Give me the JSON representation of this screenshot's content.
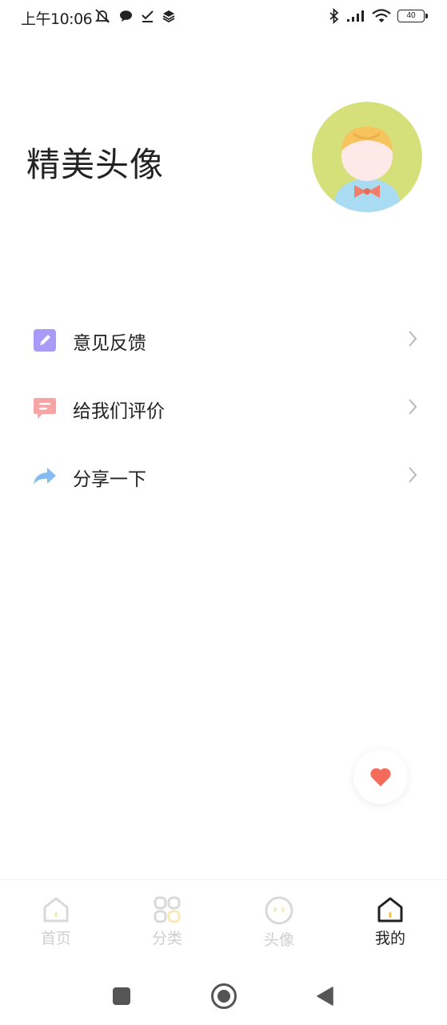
{
  "status_bar": {
    "time": "上午10:06",
    "battery": "40",
    "icons": [
      "mute-icon",
      "chat-bubble-icon",
      "check-icon",
      "layers-icon",
      "bluetooth-icon",
      "signal-icon",
      "wifi-icon",
      "battery-icon"
    ]
  },
  "header": {
    "title": "精美头像",
    "avatar_icon": "boy-avatar-icon"
  },
  "menu": {
    "items": [
      {
        "label": "意见反馈",
        "icon": "edit-pencil-icon",
        "color": "#9d8cf5"
      },
      {
        "label": "给我们评价",
        "icon": "message-icon",
        "color": "#f5a0a0"
      },
      {
        "label": "分享一下",
        "icon": "share-arrow-icon",
        "color": "#7fb9f0"
      }
    ]
  },
  "fab": {
    "icon": "heart-icon",
    "color": "#f26b5b"
  },
  "tab_bar": {
    "tabs": [
      {
        "label": "首页",
        "icon": "home-icon",
        "active": false
      },
      {
        "label": "分类",
        "icon": "category-grid-icon",
        "active": false
      },
      {
        "label": "头像",
        "icon": "face-icon",
        "active": false
      },
      {
        "label": "我的",
        "icon": "home-outline-icon",
        "active": true
      }
    ]
  },
  "system_nav": {
    "buttons": [
      "recents-square-icon",
      "home-circle-icon",
      "back-triangle-icon"
    ]
  }
}
